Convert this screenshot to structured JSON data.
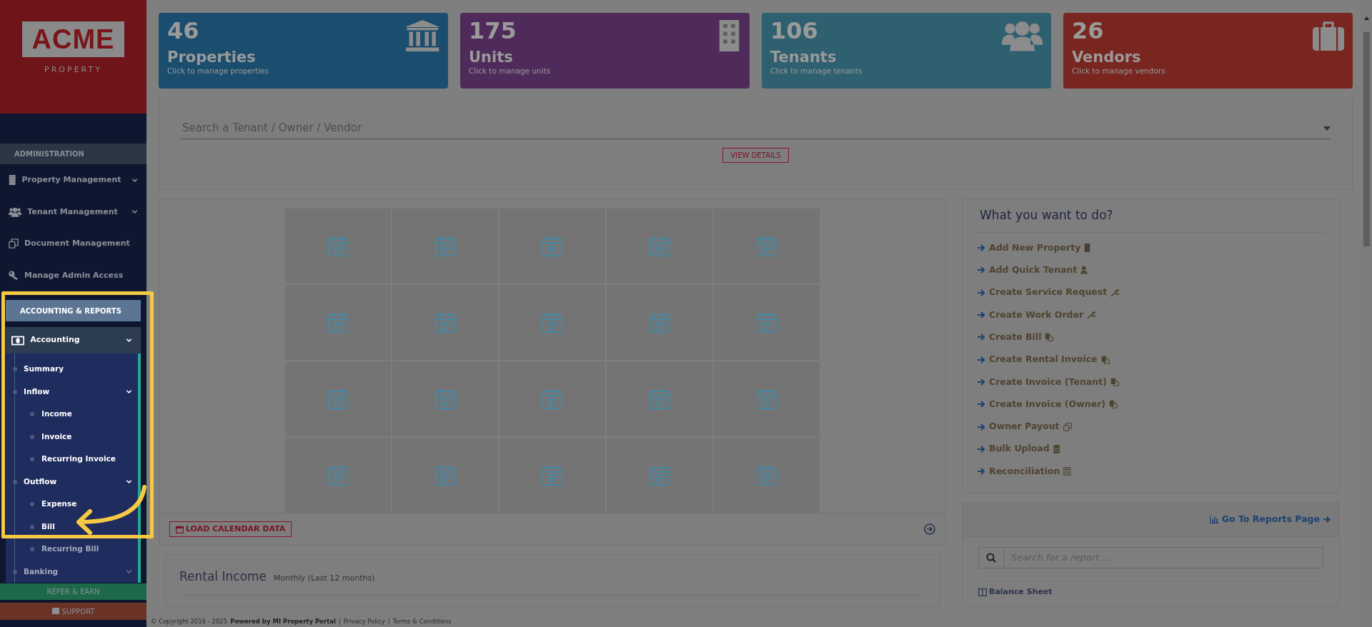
{
  "sidebar": {
    "logo": {
      "name": "ACME",
      "tagline": "PROPERTY"
    },
    "sections": [
      {
        "title": "ADMINISTRATION",
        "highlighted": false,
        "items": [
          {
            "label": "Property Management",
            "kind": "building",
            "chevron": true,
            "highlighted": false
          },
          {
            "label": "Tenant Management",
            "kind": "people",
            "chevron": true,
            "highlighted": false
          },
          {
            "label": "Document Management",
            "kind": "clone",
            "chevron": false,
            "highlighted": false
          },
          {
            "label": "Manage Admin Access",
            "kind": "key",
            "chevron": false,
            "highlighted": false
          }
        ]
      },
      {
        "title": "ACCOUNTING & REPORTS",
        "highlighted": true,
        "items": [
          {
            "label": "Accounting",
            "kind": "money",
            "chevron": true,
            "highlighted": true,
            "children": [
              {
                "label": "Summary",
                "chevron": false,
                "highlighted": true
              },
              {
                "label": "Inflow",
                "chevron": true,
                "highlighted": true,
                "children": [
                  {
                    "label": "Income",
                    "highlighted": true
                  },
                  {
                    "label": "Invoice",
                    "highlighted": true
                  },
                  {
                    "label": "Recurring Invoice",
                    "highlighted": true
                  }
                ]
              },
              {
                "label": "Outflow",
                "chevron": true,
                "highlighted": true,
                "children": [
                  {
                    "label": "Expense",
                    "highlighted": true
                  },
                  {
                    "label": "Bill",
                    "highlighted": true
                  },
                  {
                    "label": "Recurring Bill",
                    "highlighted": false
                  }
                ]
              },
              {
                "label": "Banking",
                "chevron": true,
                "highlighted": false
              }
            ]
          }
        ]
      }
    ],
    "bottom_buttons": [
      {
        "label": "REFER & EARN",
        "kind": "refer"
      },
      {
        "label": "SUPPORT",
        "kind": "support"
      }
    ]
  },
  "stats": [
    {
      "count": "46",
      "label": "Properties",
      "hint": "Click to manage properties",
      "kind": "bank",
      "color": "#1b4d6e"
    },
    {
      "count": "175",
      "label": "Units",
      "hint": "Click to manage units",
      "kind": "building",
      "color": "#4f2b5b"
    },
    {
      "count": "106",
      "label": "Tenants",
      "hint": "Click to manage tenants",
      "kind": "people",
      "color": "#2f6070"
    },
    {
      "count": "26",
      "label": "Vendors",
      "hint": "Click to manage vendors",
      "kind": "briefcase",
      "color": "#792620"
    }
  ],
  "tenant_search": {
    "placeholder": "Search a Tenant / Owner / Vendor",
    "button": "VIEW DETAILS"
  },
  "calendar": {
    "load_button": "LOAD CALENDAR DATA"
  },
  "actions": {
    "title": "What you want to do?",
    "items": [
      {
        "label": "Add New Property",
        "kind": "building"
      },
      {
        "label": "Add Quick Tenant",
        "kind": "user"
      },
      {
        "label": "Create Service Request",
        "kind": "wrench"
      },
      {
        "label": "Create Work Order",
        "kind": "wrench"
      },
      {
        "label": "Create Bill",
        "kind": "copy"
      },
      {
        "label": "Create Rental Invoice",
        "kind": "copy"
      },
      {
        "label": "Create Invoice (Tenant)",
        "kind": "copy"
      },
      {
        "label": "Create Invoice (Owner)",
        "kind": "copy"
      },
      {
        "label": "Owner Payout",
        "kind": "clone"
      },
      {
        "label": "Bulk Upload",
        "kind": "database"
      },
      {
        "label": "Reconciliation",
        "kind": "calculator"
      }
    ]
  },
  "reports": {
    "link": "Go To Reports Page",
    "search_placeholder": "Search for a report ...",
    "items": [
      {
        "label": "Balance Sheet"
      }
    ]
  },
  "rental_income": {
    "title": "Rental Income",
    "subtitle": "Monthly (Last 12 months)"
  },
  "footer": {
    "parts": [
      {
        "text": "© Copyright 2016 - 2025",
        "kind": "text"
      },
      {
        "text": "Powered by MI Property Portal",
        "kind": "bold"
      },
      {
        "text": "|",
        "kind": "separator"
      },
      {
        "text": "Privacy Policy",
        "kind": "link"
      },
      {
        "text": "|",
        "kind": "separator"
      },
      {
        "text": "Terms & Conditions",
        "kind": "link"
      }
    ]
  }
}
